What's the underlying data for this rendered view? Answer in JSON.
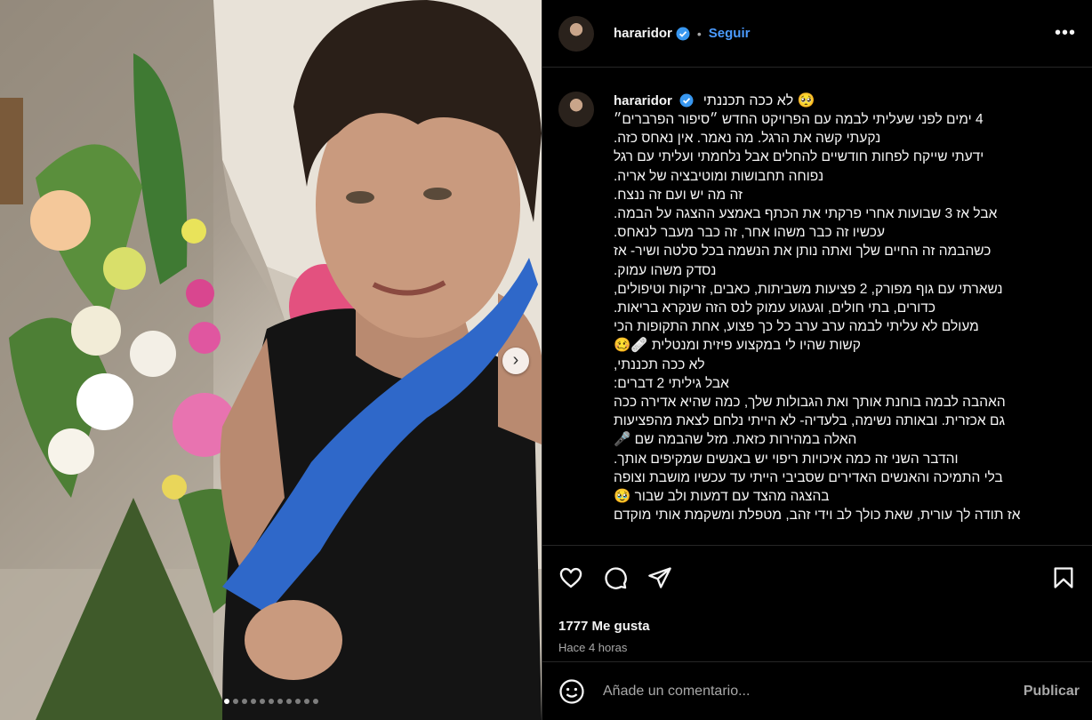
{
  "post": {
    "username": "hararidor",
    "follow_label": "Seguir",
    "more_label": "•••",
    "separator": "•",
    "caption_title": "לא ככה תכננתי 🥺",
    "caption_lines": [
      "4 ימים לפני שעליתי לבמה עם הפרויקט החדש ״סיפור הפרברים״",
      "נקעתי קשה את הרגל. מה נאמר. אין נאחס כזה.",
      "ידעתי שייקח לפחות חודשיים להחלים אבל נלחמתי ועליתי עם רגל",
      "נפוחה תחבושות ומוטיבציה של אריה.",
      "זה מה יש ועם זה ננצח.",
      "אבל אז 3 שבועות אחרי פרקתי את הכתף באמצע ההצגה על הבמה.",
      "עכשיו זה כבר משהו אחר, זה כבר מעבר לנאחס.",
      "כשהבמה זה החיים שלך ואתה נותן את הנשמה בכל סלטה ושיר- אז",
      "נסדק משהו עמוק.",
      "נשארתי עם גוף מפורק, 2 פציעות משביתות, כאבים, זריקות וטיפולים,",
      "כדורים, בתי חולים, וגעגוע עמוק לנס הזה שנקרא בריאות.",
      "מעולם לא עליתי לבמה ערב ערב כל כך פצוע, אחת התקופות הכי",
      "קשות שהיו לי במקצוע פיזית ומנטלית 🩹🥴",
      "לא ככה תכננתי,",
      "אבל גיליתי 2 דברים:",
      "האהבה לבמה בוחנת אותך ואת הגבולות שלך, כמה שהיא אדירה ככה",
      "גם אכזרית. ובאותה נשימה, בלעדיה- לא הייתי נלחם לצאת מהפציעות",
      "האלה במהירות כזאת. מזל שהבמה שם 🎤",
      "והדבר השני זה כמה איכויות ריפוי יש באנשים שמקיפים אותך.",
      "בלי התמיכה והאנשים האדירים שסביבי הייתי עד עכשיו מושבת וצופה",
      "בהצגה מהצד עם דמעות ולב שבור 🥹",
      "אז תודה לך עורית, שאת כולך לב וידי זהב, מטפלת ומשקמת אותי מוקדם"
    ],
    "likes": "1777 Me gusta",
    "time_ago": "Hace 4 horas",
    "comment_placeholder": "Añade un comentario...",
    "publish_label": "Publicar",
    "carousel_next": "›"
  },
  "icons": {
    "like": "heart-icon",
    "comment": "comment-icon",
    "share": "share-icon",
    "save": "bookmark-icon",
    "emoji": "emoji-icon",
    "verified": "verified-badge-icon",
    "more": "more-options-icon"
  },
  "colors": {
    "background": "#000000",
    "text": "#f5f5f5",
    "muted": "#a8a8a8",
    "link": "#4b9bff",
    "verified": "#3897f0",
    "border": "#262626"
  },
  "carousel": {
    "count": 11,
    "active": 1
  }
}
